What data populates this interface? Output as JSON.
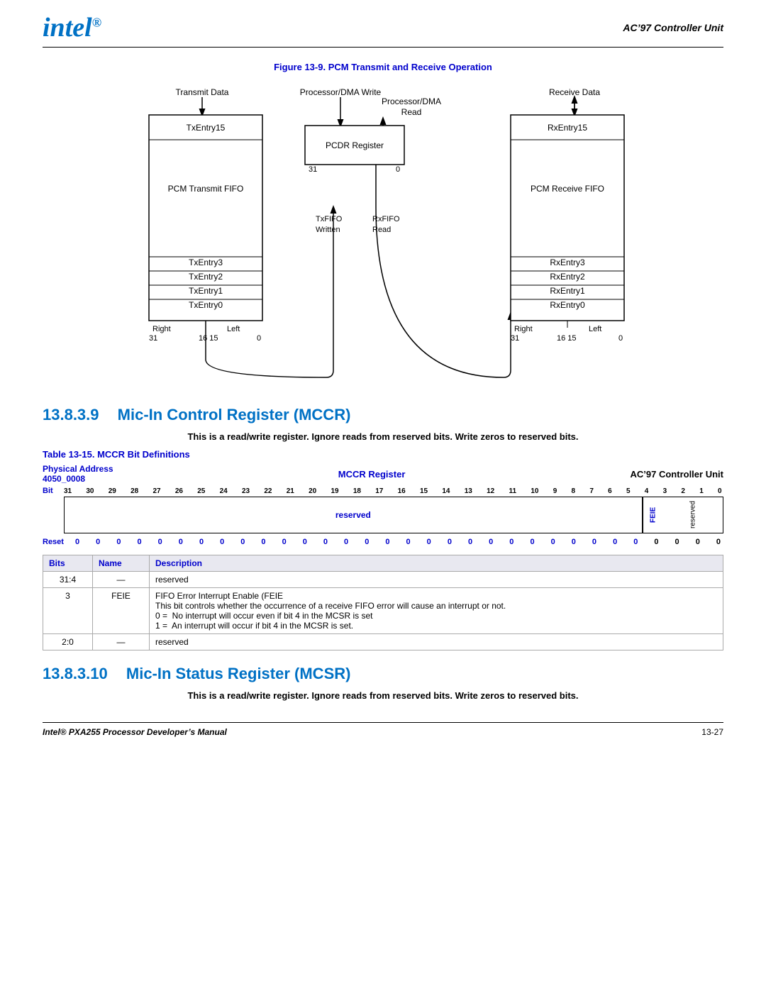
{
  "header": {
    "logo": "intеl",
    "title": "AC’97 Controller Unit"
  },
  "figure": {
    "title": "Figure 13-9. PCM Transmit and Receive Operation"
  },
  "section_1": {
    "number": "13.8.3.9",
    "title": "Mic-In Control Register (MCCR)"
  },
  "section_2": {
    "number": "13.8.3.10",
    "title": "Mic-In Status Register (MCSR)"
  },
  "bold_para": "This is a read/write register. Ignore reads from reserved bits. Write zeros to reserved bits.",
  "bold_para2": "This is a read/write register. Ignore reads from reserved bits. Write zeros to reserved bits.",
  "table_title": "Table 13-15. MCCR Bit Definitions",
  "reg_header": {
    "left_label": "Physical Address",
    "left_value": "4050_0008",
    "center": "MCCR Register",
    "right": "AC’97 Controller Unit"
  },
  "bit_numbers": [
    "31",
    "30",
    "29",
    "28",
    "27",
    "26",
    "25",
    "24",
    "23",
    "22",
    "21",
    "20",
    "19",
    "18",
    "17",
    "16",
    "15",
    "14",
    "13",
    "12",
    "11",
    "10",
    "9",
    "8",
    "7",
    "6",
    "5",
    "4",
    "3",
    "2",
    "1",
    "0"
  ],
  "bit_label": "Bit",
  "reset_label": "Reset",
  "reset_values": [
    "0",
    "0",
    "0",
    "0",
    "0",
    "0",
    "0",
    "0",
    "0",
    "0",
    "0",
    "0",
    "0",
    "0",
    "0",
    "0",
    "0",
    "0",
    "0",
    "0",
    "0",
    "0",
    "0",
    "0",
    "0",
    "0",
    "0",
    "0",
    "0",
    "0",
    "0",
    "0"
  ],
  "register_segments": [
    {
      "label": "reserved",
      "type": "reserved-wide"
    },
    {
      "label": "FEIE",
      "type": "feie-seg"
    },
    {
      "label": "reserved",
      "type": "reserved-small"
    }
  ],
  "table_headers": [
    "Bits",
    "Name",
    "Description"
  ],
  "table_rows": [
    {
      "bits": "31:4",
      "name": "—",
      "description": "reserved"
    },
    {
      "bits": "3",
      "name": "FEIE",
      "description": "FIFO Error Interrupt Enable (FEIE\nThis bit controls whether the occurrence of a receive FIFO error will cause an interrupt or not.\n0 =  No interrupt will occur even if bit 4 in the MCSR is set\n1 =  An interrupt will occur if bit 4 in the MCSR is set."
    },
    {
      "bits": "2:0",
      "name": "—",
      "description": "reserved"
    }
  ],
  "footer": {
    "left": "Intel® PXA255 Processor Developer’s Manual",
    "right": "13-27"
  }
}
